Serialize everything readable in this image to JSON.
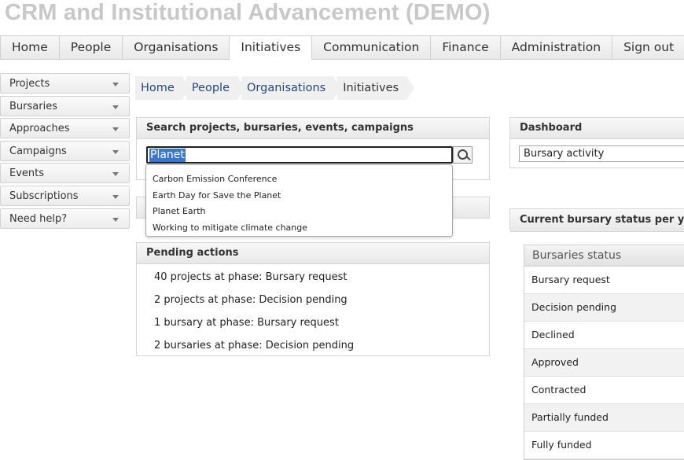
{
  "app": {
    "title": "CRM and Institutional Advancement (DEMO)"
  },
  "topnav": [
    "Home",
    "People",
    "Organisations",
    "Initiatives",
    "Communication",
    "Finance",
    "Administration",
    "Sign out"
  ],
  "topnav_active": "Initiatives",
  "sidebar": {
    "items": [
      {
        "label": "Projects"
      },
      {
        "label": "Bursaries"
      },
      {
        "label": "Approaches"
      },
      {
        "label": "Campaigns"
      },
      {
        "label": "Events"
      },
      {
        "label": "Subscriptions"
      },
      {
        "label": "Need help?"
      }
    ]
  },
  "breadcrumb": [
    "Home",
    "People",
    "Organisations",
    "Initiatives"
  ],
  "search": {
    "title": "Search projects, bursaries, events, campaigns",
    "value": "Planet",
    "suggestions": [
      "Carbon Emission Conference",
      "Earth Day for Save the Planet",
      "Planet Earth",
      "Working to mitigate climate change"
    ]
  },
  "pending": {
    "title": "Pending actions",
    "items": [
      "40 projects at phase: Bursary request",
      "2 projects at phase: Decision pending",
      "1 bursary at phase: Bursary request",
      "2 bursaries at phase: Decision pending"
    ]
  },
  "dashboard": {
    "title": "Dashboard",
    "selected": "Bursary activity"
  },
  "status_per_year": {
    "title": "Current bursary status per year"
  },
  "bursaries_status": {
    "header": "Bursaries status",
    "rows": [
      "Bursary request",
      "Decision pending",
      "Declined",
      "Approved",
      "Contracted",
      "Partially funded",
      "Fully funded"
    ]
  }
}
